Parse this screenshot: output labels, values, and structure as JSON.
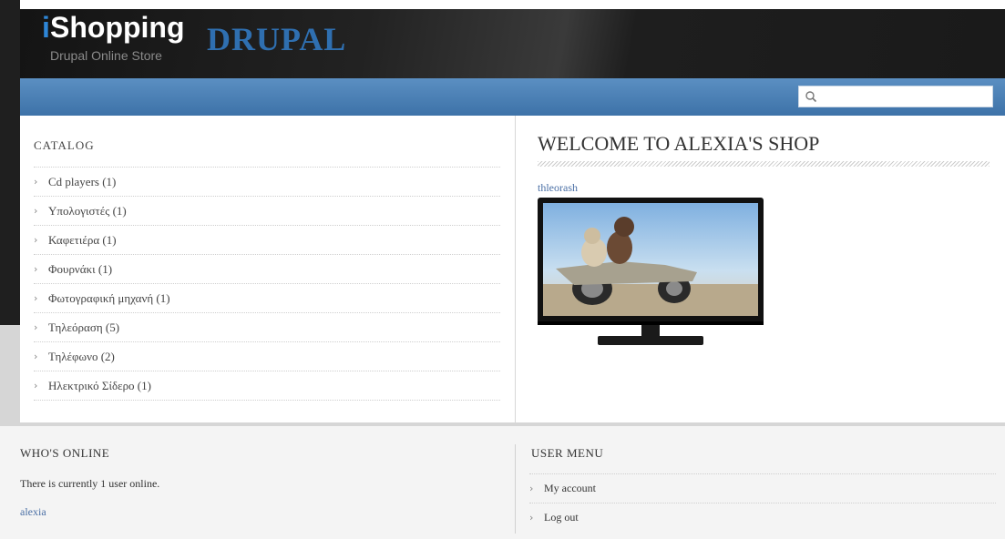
{
  "header": {
    "logo_i": "i",
    "logo_shopping": "Shopping",
    "logo_drupal": "DRUPAL",
    "tagline": "Drupal Online Store"
  },
  "search": {
    "placeholder": ""
  },
  "catalog": {
    "title": "CATALOG",
    "items": [
      {
        "label": "Cd players (1)"
      },
      {
        "label": "Υπολογιστές (1)"
      },
      {
        "label": "Καφετιέρα (1)"
      },
      {
        "label": "Φουρνάκι (1)"
      },
      {
        "label": "Φωτογραφική μηχανή (1)"
      },
      {
        "label": "Τηλεόραση (5)"
      },
      {
        "label": "Τηλέφωνο (2)"
      },
      {
        "label": "Ηλεκτρικό Σίδερο (1)"
      }
    ]
  },
  "main": {
    "title": "WELCOME TO ALEXIA'S SHOP",
    "product_link": "thleorash"
  },
  "footer": {
    "whos_online_title": "WHO'S ONLINE",
    "whos_online_text": "There is currently 1 user online.",
    "online_user": "alexia",
    "user_menu_title": "USER MENU",
    "user_menu_items": [
      {
        "label": "My account"
      },
      {
        "label": "Log out"
      }
    ]
  },
  "colors": {
    "nav_blue": "#3d72a8",
    "brand_blue": "#2e86d6",
    "link_blue": "#4a6fa5"
  }
}
